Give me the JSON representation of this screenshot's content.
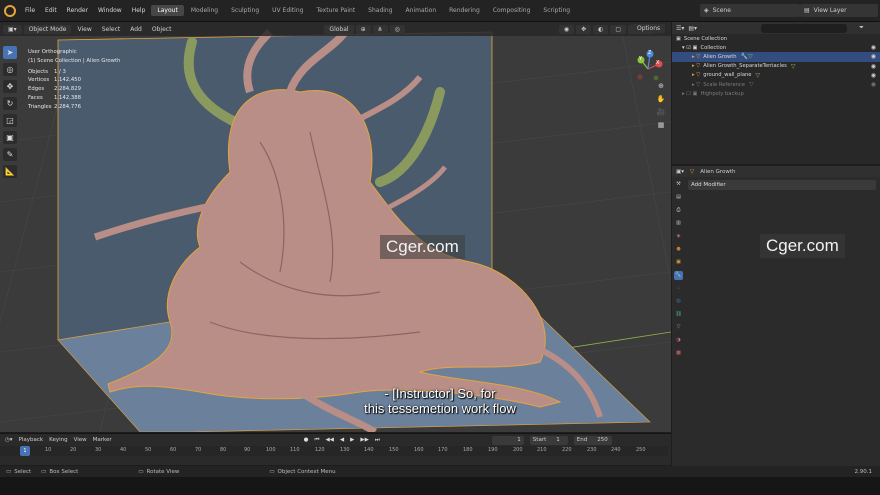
{
  "topbar": {
    "menu": [
      "File",
      "Edit",
      "Render",
      "Window",
      "Help"
    ],
    "workspaces": [
      "Layout",
      "Modeling",
      "Sculpting",
      "UV Editing",
      "Texture Paint",
      "Shading",
      "Animation",
      "Rendering",
      "Compositing",
      "Scripting"
    ],
    "active_workspace": "Layout",
    "scene": "Scene",
    "view_layer": "View Layer"
  },
  "viewport": {
    "header": {
      "mode": "Object Mode",
      "view": "View",
      "select": "Select",
      "add": "Add",
      "object": "Object",
      "transform_orientation": "Global",
      "options": "Options"
    },
    "overlay_info": {
      "view_name": "User Orthographic",
      "collection_path": "(1) Scene Collection | Alien Growth",
      "stats": [
        {
          "key": "Objects",
          "value": "1 / 3"
        },
        {
          "key": "Vertices",
          "value": "1,142,450"
        },
        {
          "key": "Edges",
          "value": "2,284,829"
        },
        {
          "key": "Faces",
          "value": "1,142,388"
        },
        {
          "key": "Triangles",
          "value": "2,284,776"
        }
      ]
    },
    "gizmo": {
      "x": "X",
      "y": "Y",
      "z": "Z"
    },
    "subtitle": {
      "line1": "- [Instructor] So, for",
      "line2": "this tessemetion work flow"
    },
    "watermark": "Cger.com"
  },
  "outliner": {
    "root": "Scene Collection",
    "items": [
      {
        "label": "Collection",
        "indent": 1,
        "selected": false,
        "dim": false
      },
      {
        "label": "Alien Growth",
        "indent": 2,
        "selected": true,
        "dim": false
      },
      {
        "label": "Alien Growth_SeparateTentacles",
        "indent": 2,
        "selected": false,
        "dim": false
      },
      {
        "label": "ground_wall_plane",
        "indent": 2,
        "selected": false,
        "dim": false
      },
      {
        "label": "Scale Reference",
        "indent": 2,
        "selected": false,
        "dim": true
      },
      {
        "label": "Highpoly backup",
        "indent": 1,
        "selected": false,
        "dim": true
      }
    ]
  },
  "properties": {
    "object_name": "Alien Growth",
    "add_modifier": "Add Modifier",
    "watermark": "Cger.com"
  },
  "timeline": {
    "menus": [
      "Playback",
      "Keying",
      "View",
      "Marker"
    ],
    "current_frame": "1",
    "start_label": "Start",
    "start_value": "1",
    "end_label": "End",
    "end_value": "250",
    "ticks": [
      "1",
      "10",
      "20",
      "30",
      "40",
      "50",
      "60",
      "70",
      "80",
      "90",
      "100",
      "110",
      "120",
      "130",
      "140",
      "150",
      "160",
      "170",
      "180",
      "190",
      "200",
      "210",
      "220",
      "230",
      "240",
      "250"
    ]
  },
  "statusbar": {
    "select": "Select",
    "box_select": "Box Select",
    "rotate_view": "Rotate View",
    "context_menu": "Object Context Menu",
    "version": "2.90.1"
  },
  "colors": {
    "accent": "#4772b3",
    "selection_outline": "#e8a33c",
    "model": "#b98e87"
  }
}
